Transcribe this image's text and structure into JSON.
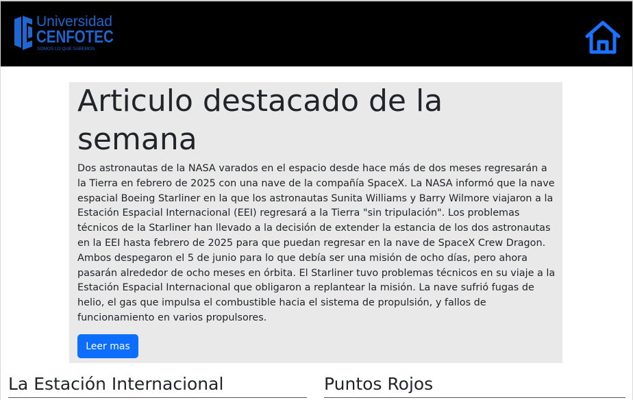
{
  "header": {
    "logo": {
      "line1": "Universidad",
      "line2": "CENFOTEC",
      "tagline": "SOMOS LO QUE SABEMOS"
    },
    "home_icon": "home-icon",
    "brand_color": "#1f66d0"
  },
  "featured": {
    "title": "Articulo destacado de la semana",
    "body": "Dos astronautas de la NASA varados en el espacio desde hace más de dos meses regresarán a la Tierra en febrero de 2025 con una nave de la compañía SpaceX. La NASA informó que la nave espacial Boeing Starliner en la que los astronautas Sunita Williams y Barry Wilmore viajaron a la Estación Espacial Internacional (EEI) regresará a la Tierra \"sin tripulación\". Los problemas técnicos de la Starliner han llevado a la decisión de extender la estancia de los dos astronautas en la EEI hasta febrero de 2025 para que puedan regresar en la nave de SpaceX Crew Dragon. Ambos despegaron el 5 de junio para lo que debía ser una misión de ocho días, pero ahora pasarán alrededor de ocho meses en órbita. El Starliner tuvo problemas técnicos en su viaje a la Estación Espacial Internacional que obligaron a replantear la misión. La nave sufrió fugas de helio, el gas que impulsa el combustible hacia el sistema de propulsión, y fallos de funcionamiento en varios propulsores.",
    "button_label": "Leer mas",
    "button_color": "#0d6efd"
  },
  "sections": [
    {
      "title": "La Estación Internacional"
    },
    {
      "title": "Puntos Rojos"
    }
  ]
}
